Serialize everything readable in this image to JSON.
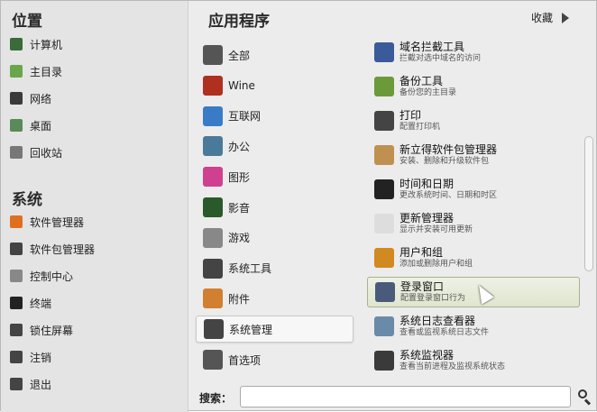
{
  "places": {
    "title": "位置",
    "items": [
      {
        "label": "计算机",
        "icon": "computer-icon",
        "color": "#3b6a3b"
      },
      {
        "label": "主目录",
        "icon": "home-folder-icon",
        "color": "#6aa64a"
      },
      {
        "label": "网络",
        "icon": "network-icon",
        "color": "#3a3a3a"
      },
      {
        "label": "桌面",
        "icon": "desktop-icon",
        "color": "#5a8a5a"
      },
      {
        "label": "回收站",
        "icon": "trash-icon",
        "color": "#777777"
      }
    ]
  },
  "system": {
    "title": "系统",
    "items": [
      {
        "label": "软件管理器",
        "icon": "software-manager-icon",
        "color": "#e07020"
      },
      {
        "label": "软件包管理器",
        "icon": "package-manager-icon",
        "color": "#444444"
      },
      {
        "label": "控制中心",
        "icon": "control-center-icon",
        "color": "#888888"
      },
      {
        "label": "终端",
        "icon": "terminal-icon",
        "color": "#222222"
      },
      {
        "label": "锁住屏幕",
        "icon": "lock-icon",
        "color": "#444444"
      },
      {
        "label": "注销",
        "icon": "logout-icon",
        "color": "#444444"
      },
      {
        "label": "退出",
        "icon": "power-icon",
        "color": "#444444"
      }
    ]
  },
  "applications": {
    "title": "应用程序",
    "favorites_label": "收藏",
    "categories": [
      {
        "label": "全部",
        "icon": "all-apps-icon",
        "color": "#555555"
      },
      {
        "label": "Wine",
        "icon": "wine-icon",
        "color": "#b03020"
      },
      {
        "label": "互联网",
        "icon": "internet-icon",
        "color": "#3a7bc8"
      },
      {
        "label": "办公",
        "icon": "office-icon",
        "color": "#4a7a9a"
      },
      {
        "label": "图形",
        "icon": "graphics-icon",
        "color": "#d04090"
      },
      {
        "label": "影音",
        "icon": "multimedia-icon",
        "color": "#2a5a2a"
      },
      {
        "label": "游戏",
        "icon": "games-icon",
        "color": "#888888"
      },
      {
        "label": "系统工具",
        "icon": "system-tools-icon",
        "color": "#444444"
      },
      {
        "label": "附件",
        "icon": "accessories-icon",
        "color": "#d08030"
      },
      {
        "label": "系统管理",
        "icon": "administration-icon",
        "color": "#444444",
        "selected": true
      },
      {
        "label": "首选项",
        "icon": "preferences-icon",
        "color": "#555555"
      }
    ],
    "apps": [
      {
        "name": "域名拦截工具",
        "desc": "拦截对选中域名的访问",
        "icon": "domain-blocker-icon",
        "color": "#3a5a9a"
      },
      {
        "name": "备份工具",
        "desc": "备份您的主目录",
        "icon": "backup-icon",
        "color": "#6a9a3a"
      },
      {
        "name": "打印",
        "desc": "配置打印机",
        "icon": "printer-icon",
        "color": "#444444"
      },
      {
        "name": "新立得软件包管理器",
        "desc": "安装、删除和升级软件包",
        "icon": "synaptic-icon",
        "color": "#c09050"
      },
      {
        "name": "时间和日期",
        "desc": "更改系统时间、日期和时区",
        "icon": "clock-icon",
        "color": "#222222"
      },
      {
        "name": "更新管理器",
        "desc": "显示并安装可用更新",
        "icon": "shield-icon",
        "color": "#dddddd"
      },
      {
        "name": "用户和组",
        "desc": "添加或删除用户和组",
        "icon": "users-icon",
        "color": "#d08a20"
      },
      {
        "name": "登录窗口",
        "desc": "配置登录窗口行为",
        "icon": "login-window-icon",
        "color": "#4a5a7a",
        "selected": true
      },
      {
        "name": "系统日志查看器",
        "desc": "查看或监视系统日志文件",
        "icon": "log-viewer-icon",
        "color": "#6a8aaa"
      },
      {
        "name": "系统监视器",
        "desc": "查看当前进程及监视系统状态",
        "icon": "system-monitor-icon",
        "color": "#3a3a3a"
      }
    ]
  },
  "search": {
    "label": "搜索：",
    "value": "",
    "placeholder": ""
  }
}
